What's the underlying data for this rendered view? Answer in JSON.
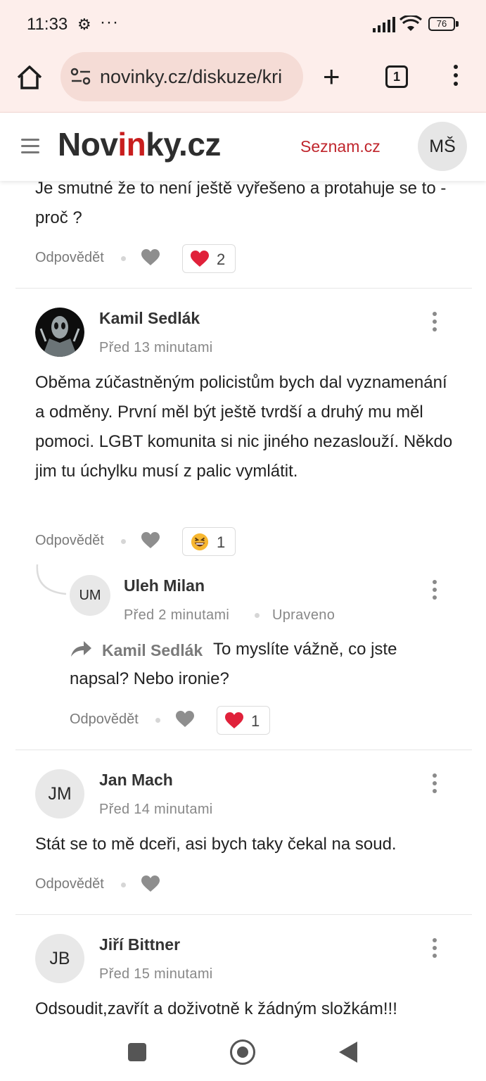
{
  "status": {
    "time": "11:33",
    "dots": "···",
    "battery": "76"
  },
  "browser": {
    "url": "novinky.cz/diskuze/kri",
    "tab_count": "1"
  },
  "site": {
    "logo_pre": "Nov",
    "logo_red": "in",
    "logo_post": "ky.cz",
    "seznam": "Seznam.cz",
    "user_initials": "MŠ"
  },
  "comments": [
    {
      "text": "Je smutné že to není ještě vyřešeno a protahuje se to - proč ?",
      "reply_label": "Odpovědět",
      "reaction": {
        "type": "heart",
        "count": "2"
      }
    },
    {
      "author": "Kamil Sedlák",
      "time": "Před 13 minutami",
      "text": "Oběma zúčastněným policistům bych dal vyznamenání a odměny. První měl být ještě tvrdší a druhý mu měl pomoci. LGBT komunita si nic jiného nezaslouží. Někdo jim tu úchylku musí z palic vymlátit.",
      "reply_label": "Odpovědět",
      "reaction": {
        "type": "laugh",
        "count": "1"
      }
    },
    {
      "initials": "UM",
      "author": "Uleh Milan",
      "time": "Před 2 minutami",
      "edited": "Upraveno",
      "reply_to": "Kamil Sedlák",
      "text": "To myslíte vážně, co jste napsal? Nebo ironie?",
      "reply_label": "Odpovědět",
      "reaction": {
        "type": "heart",
        "count": "1"
      }
    },
    {
      "initials": "JM",
      "author": "Jan Mach",
      "time": "Před 14 minutami",
      "text": "Stát se to mě dceři, asi bych taky čekal na soud.",
      "reply_label": "Odpovědět"
    },
    {
      "initials": "JB",
      "author": "Jiří Bittner",
      "time": "Před 15 minutami",
      "text": "Odsoudit,zavřít a doživotně k žádným složkám!!!"
    }
  ],
  "colors": {
    "accent_red": "#c81e1e",
    "heart": "#e0213a",
    "chrome_bg": "#fdeeeb"
  }
}
